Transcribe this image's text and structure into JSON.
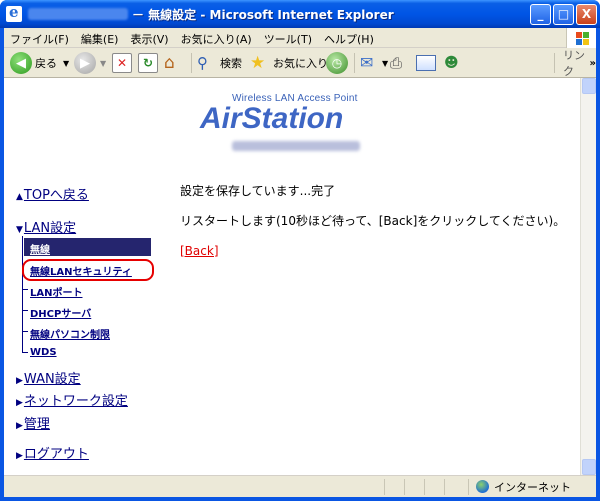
{
  "window": {
    "title": "－ 無線設定 - Microsoft Internet Explorer",
    "controls": [
      "_",
      "□",
      "X"
    ]
  },
  "menu": [
    "ファイル(F)",
    "編集(E)",
    "表示(V)",
    "お気に入り(A)",
    "ツール(T)",
    "ヘルプ(H)"
  ],
  "toolbar": {
    "back_label": "戻る",
    "search_label": "検索",
    "favorites_label": "お気に入り",
    "links_label": "リンク"
  },
  "logo": {
    "subtitle": "Wireless LAN Access Point",
    "brand": "AirStation"
  },
  "nav": {
    "top": "TOPへ戻る",
    "lan": "LAN設定",
    "lan_items": [
      "無線",
      "無線LANセキュリティ",
      "LANポート",
      "DHCPサーバ",
      "無線パソコン制限",
      "WDS"
    ],
    "wan": "WAN設定",
    "network": "ネットワーク設定",
    "admin": "管理",
    "logout": "ログアウト"
  },
  "main": {
    "message1": "設定を保存しています...完了",
    "message2": "リスタートします(10秒ほど待って、[Back]をクリックしてください)。",
    "back_link": "[Back]"
  },
  "status": {
    "zone": "インターネット"
  },
  "colors": {
    "title_bar": "#0055e5",
    "nav_link": "#000080",
    "active_item": "#25256e",
    "highlight": "#e60000",
    "back_link": "#e00000",
    "logo": "#3e66c4"
  }
}
